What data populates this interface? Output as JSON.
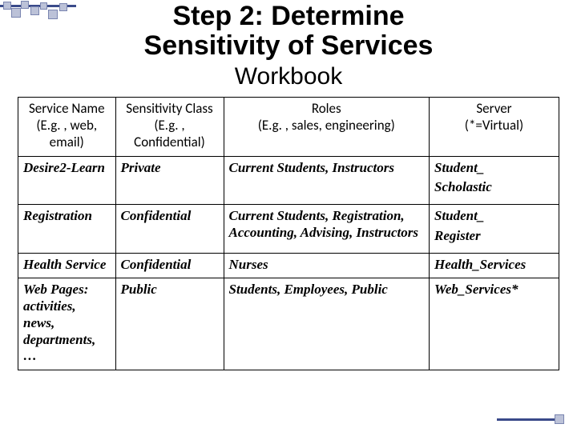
{
  "title_line1": "Step 2: Determine",
  "title_line2": "Sensitivity of Services",
  "subtitle": "Workbook",
  "headers": {
    "service_name": "Service Name",
    "service_name_hint": "(E.g. , web, email)",
    "sensitivity": "Sensitivity Class",
    "sensitivity_hint": "(E.g. , Confidential)",
    "roles": "Roles",
    "roles_hint": "(E.g. , sales, engineering)",
    "server": "Server",
    "server_hint": "(*=Virtual)"
  },
  "rows": [
    {
      "name": "Desire2-Learn",
      "sens": "Private",
      "roles": "Current Students, Instructors",
      "server1": "Student_",
      "server2": "Scholastic"
    },
    {
      "name": "Registration",
      "sens": "Confidential",
      "roles": "Current Students, Registration, Accounting, Advising, Instructors",
      "server1": "Student_",
      "server2": "Register"
    },
    {
      "name": "Health Service",
      "sens": "Confidential",
      "roles": "Nurses",
      "server1": "Health_Services",
      "server2": ""
    },
    {
      "name": "Web Pages: activities, news, departments, …",
      "sens": "Public",
      "roles": "Students, Employees, Public",
      "server1": "Web_Services*",
      "server2": ""
    }
  ]
}
